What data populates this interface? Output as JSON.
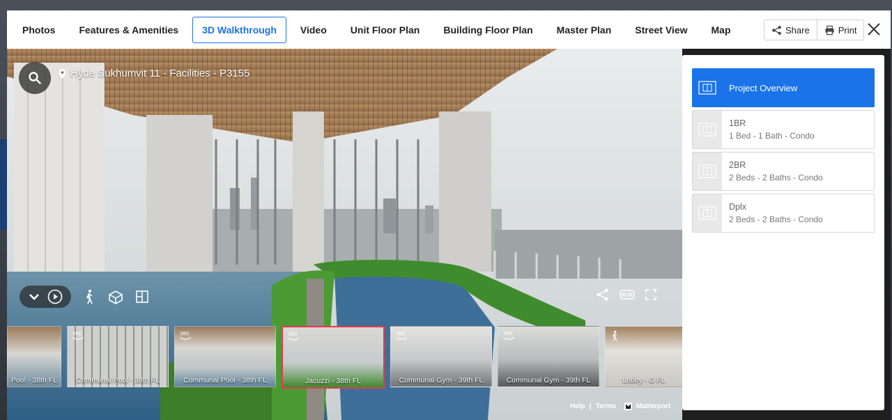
{
  "tabs": [
    {
      "label": "Photos",
      "active": false
    },
    {
      "label": "Features & Amenities",
      "active": false
    },
    {
      "label": "3D Walkthrough",
      "active": true
    },
    {
      "label": "Video",
      "active": false
    },
    {
      "label": "Unit Floor Plan",
      "active": false
    },
    {
      "label": "Building Floor Plan",
      "active": false
    },
    {
      "label": "Master Plan",
      "active": false
    },
    {
      "label": "Street View",
      "active": false
    },
    {
      "label": "Map",
      "active": false
    }
  ],
  "actions": {
    "share_label": "Share",
    "print_label": "Print"
  },
  "viewer": {
    "location_title": "Hyde Sukhumvit 11 - Facilities - P3155",
    "thumbnails": [
      {
        "label": "Pool - 38th FL",
        "badge": ""
      },
      {
        "label": "Communal Pool - 38th FL",
        "badge": "360"
      },
      {
        "label": "Communal Pool - 38th FL",
        "badge": "360"
      },
      {
        "label": "Jacuzzi - 38th FL",
        "badge": "360",
        "active": true
      },
      {
        "label": "Communal Gym - 39th FL",
        "badge": "360"
      },
      {
        "label": "Communal Gym - 39th FL",
        "badge": "360"
      },
      {
        "label": "Lobby - G FL",
        "badge": "walk"
      }
    ],
    "footer": {
      "help": "Help",
      "sep": "|",
      "terms": "Terms",
      "brand": "Matterport"
    }
  },
  "sidebar": {
    "plans": [
      {
        "name": "Project Overview",
        "sub": "",
        "active": true
      },
      {
        "name": "1BR",
        "sub": "1 Bed - 1 Bath - Condo",
        "active": false
      },
      {
        "name": "2BR",
        "sub": "2 Beds - 2 Baths - Condo",
        "active": false
      },
      {
        "name": "Dplx",
        "sub": "2 Beds - 2 Baths - Condo",
        "active": false
      }
    ]
  },
  "colors": {
    "accent": "#1a73e8",
    "active_thumb": "#e53950"
  }
}
